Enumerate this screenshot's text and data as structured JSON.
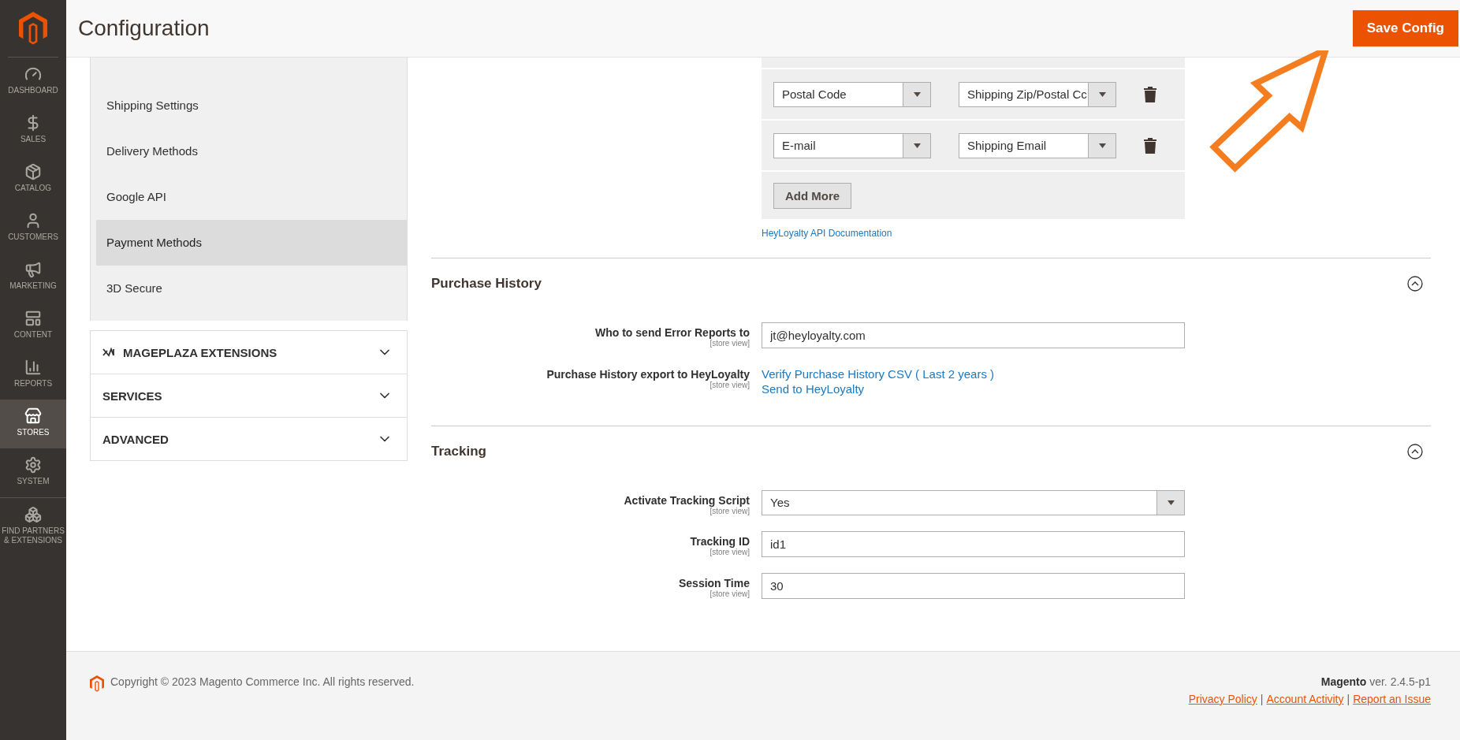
{
  "nav": [
    {
      "label": "DASHBOARD",
      "selected": false
    },
    {
      "label": "SALES",
      "selected": false
    },
    {
      "label": "CATALOG",
      "selected": false
    },
    {
      "label": "CUSTOMERS",
      "selected": false
    },
    {
      "label": "MARKETING",
      "selected": false
    },
    {
      "label": "CONTENT",
      "selected": false
    },
    {
      "label": "REPORTS",
      "selected": false
    },
    {
      "label": "STORES",
      "selected": true
    },
    {
      "label": "SYSTEM",
      "selected": false
    },
    {
      "label": "FIND PARTNERS & EXTENSIONS",
      "selected": false
    }
  ],
  "header": {
    "title": "Configuration",
    "save_button": "Save Config"
  },
  "config_menu": [
    {
      "label": "Shipping Settings",
      "selected": false
    },
    {
      "label": "Delivery Methods",
      "selected": false
    },
    {
      "label": "Google API",
      "selected": false
    },
    {
      "label": "Payment Methods",
      "selected": true
    },
    {
      "label": "3D Secure",
      "selected": false
    }
  ],
  "config_sections": [
    {
      "label": "MAGEPLAZA EXTENSIONS",
      "has_logo": true,
      "expanded": false
    },
    {
      "label": "SERVICES",
      "has_logo": false,
      "expanded": false
    },
    {
      "label": "ADVANCED",
      "has_logo": false,
      "expanded": false
    }
  ],
  "mapping_rows": [
    {
      "field": "Postal Code",
      "target": "Shipping Zip/Postal Cc"
    },
    {
      "field": "E-mail",
      "target": "Shipping Email"
    }
  ],
  "add_more_button": "Add More",
  "doc_link": "HeyLoyalty API Documentation",
  "groups": [
    {
      "title": "Purchase History",
      "expanded": true,
      "fields": [
        {
          "kind": "input",
          "label": "Who to send Error Reports to",
          "scope": "[store view]",
          "value": "jt@heyloyalty.com"
        },
        {
          "kind": "links",
          "label": "Purchase History export to HeyLoyalty",
          "scope": "[store view]",
          "links": [
            "Verify Purchase History CSV ( Last 2 years )",
            "Send to HeyLoyalty"
          ]
        }
      ]
    },
    {
      "title": "Tracking",
      "expanded": true,
      "fields": [
        {
          "kind": "select",
          "label": "Activate Tracking Script",
          "scope": "[store view]",
          "value": "Yes"
        },
        {
          "kind": "input",
          "label": "Tracking ID",
          "scope": "[store view]",
          "value": "id1"
        },
        {
          "kind": "input",
          "label": "Session Time",
          "scope": "[store view]",
          "value": "30"
        }
      ]
    }
  ],
  "footer": {
    "copyright": "Copyright © 2023 Magento Commerce Inc. All rights reserved.",
    "brand": "Magento",
    "version": "ver. 2.4.5-p1",
    "links": [
      "Privacy Policy",
      "Account Activity",
      "Report an Issue"
    ],
    "separator": "|"
  }
}
